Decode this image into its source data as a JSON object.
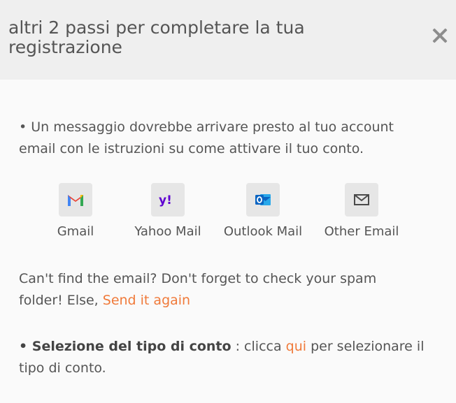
{
  "modal": {
    "title": "altri 2 passi per completare la tua registrazione"
  },
  "message": {
    "text": "• Un messaggio dovrebbe arrivare presto al tuo account email con le istruzioni su come attivare il tuo conto."
  },
  "providers": [
    {
      "label": "Gmail",
      "icon": "gmail-icon",
      "color": "#ea4335"
    },
    {
      "label": "Yahoo Mail",
      "icon": "yahoo-icon",
      "color": "#5f01d1"
    },
    {
      "label": "Outlook Mail",
      "icon": "outlook-icon",
      "color": "#0a64c2"
    },
    {
      "label": "Other Email",
      "icon": "envelope-icon",
      "color": "#4a4a4a"
    }
  ],
  "resend": {
    "text": "Can't find the email? Don't forget to check your spam folder! Else, ",
    "link": "Send it again"
  },
  "account_type": {
    "bullet": "• ",
    "bold": "Selezione del tipo di conto",
    "middle": " : clicca ",
    "link": "qui",
    "end": " per selezionare il tipo di conto."
  },
  "colors": {
    "link": "#f07a3a",
    "header_bg": "#efefef"
  }
}
